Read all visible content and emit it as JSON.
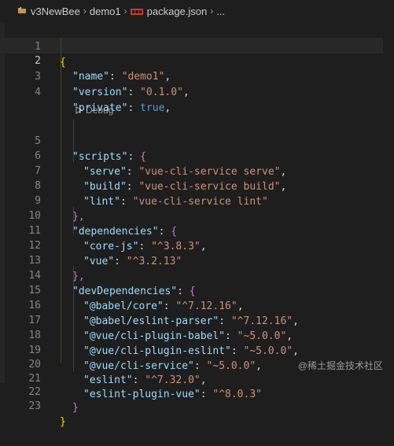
{
  "breadcrumb": {
    "items": [
      "v3NewBee",
      "demo1",
      "package.json",
      "..."
    ],
    "separator": "›"
  },
  "codelens": {
    "label": "Debug"
  },
  "editor": {
    "active_line": 2,
    "lines": [
      {
        "n": "1",
        "text": "{"
      },
      {
        "n": "2",
        "text": "\"name\": \"demo1\","
      },
      {
        "n": "3",
        "text": "\"version\": \"0.1.0\","
      },
      {
        "n": "4",
        "text": "\"private\": true,"
      },
      {
        "n": "5",
        "text": "\"scripts\": {"
      },
      {
        "n": "6",
        "text": "\"serve\": \"vue-cli-service serve\","
      },
      {
        "n": "7",
        "text": "\"build\": \"vue-cli-service build\","
      },
      {
        "n": "8",
        "text": "\"lint\": \"vue-cli-service lint\""
      },
      {
        "n": "9",
        "text": "},"
      },
      {
        "n": "10",
        "text": "\"dependencies\": {"
      },
      {
        "n": "11",
        "text": "\"core-js\": \"^3.8.3\","
      },
      {
        "n": "12",
        "text": "\"vue\": \"^3.2.13\""
      },
      {
        "n": "13",
        "text": "},"
      },
      {
        "n": "14",
        "text": "\"devDependencies\": {"
      },
      {
        "n": "15",
        "text": "\"@babel/core\": \"^7.12.16\","
      },
      {
        "n": "16",
        "text": "\"@babel/eslint-parser\": \"^7.12.16\","
      },
      {
        "n": "17",
        "text": "\"@vue/cli-plugin-babel\": \"~5.0.0\","
      },
      {
        "n": "18",
        "text": "\"@vue/cli-plugin-eslint\": \"~5.0.0\","
      },
      {
        "n": "19",
        "text": "\"@vue/cli-service\": \"~5.0.0\","
      },
      {
        "n": "20",
        "text": "\"eslint\": \"^7.32.0\","
      },
      {
        "n": "21",
        "text": "\"eslint-plugin-vue\": \"^8.0.3\""
      },
      {
        "n": "22",
        "text": "}"
      },
      {
        "n": "23",
        "text": "}"
      }
    ]
  },
  "watermark": "@稀土掘金技术社区",
  "colors": {
    "background": "#1e1e1e",
    "key": "#9cdcfe",
    "string": "#ce9178",
    "keyword": "#569cd6",
    "bracket_level1": "#ffd700",
    "bracket_level2": "#da70d6",
    "bracket_level3": "#179fff"
  }
}
